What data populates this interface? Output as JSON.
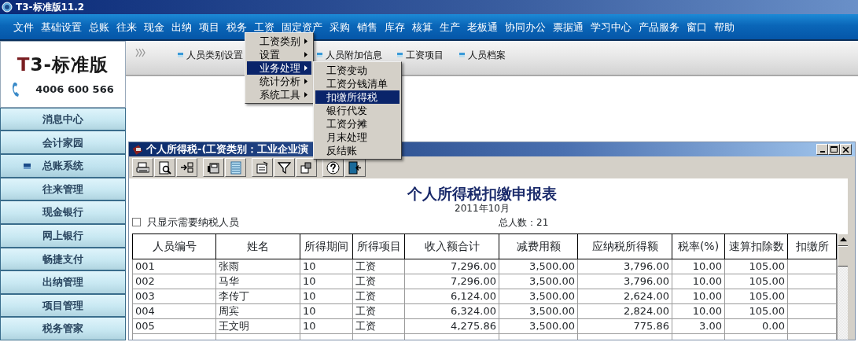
{
  "window": {
    "title": "T3-标准版11.2"
  },
  "menu_bar": [
    "文件",
    "基础设置",
    "总账",
    "往来",
    "现金",
    "出纳",
    "项目",
    "税务",
    "工资",
    "固定资产",
    "采购",
    "销售",
    "库存",
    "核算",
    "生产",
    "老板通",
    "协同办公",
    "票据通",
    "学习中心",
    "产品服务",
    "窗口",
    "帮助"
  ],
  "open_menu": [
    {
      "label": "工资类别",
      "selected": false
    },
    {
      "label": "设置",
      "selected": false
    },
    {
      "label": "业务处理",
      "selected": true
    },
    {
      "label": "统计分析",
      "selected": false
    },
    {
      "label": "系统工具",
      "selected": false
    }
  ],
  "submenu": [
    {
      "label": "工资变动",
      "selected": false
    },
    {
      "label": "工资分钱清单",
      "selected": false
    },
    {
      "label": "扣缴所得税",
      "selected": true
    },
    {
      "label": "银行代发",
      "selected": false
    },
    {
      "label": "工资分摊",
      "selected": false
    },
    {
      "label": "月末处理",
      "selected": false
    },
    {
      "label": "反结账",
      "selected": false
    }
  ],
  "sidebar": {
    "logo": "T3-标准版",
    "phone": "4006 600 566",
    "items": [
      {
        "label": "消息中心",
        "selected": false
      },
      {
        "label": "会计家园",
        "selected": false
      },
      {
        "label": "总账系统",
        "selected": true
      },
      {
        "label": "往来管理",
        "selected": false
      },
      {
        "label": "现金银行",
        "selected": false
      },
      {
        "label": "网上银行",
        "selected": false
      },
      {
        "label": "畅捷支付",
        "selected": false
      },
      {
        "label": "出纳管理",
        "selected": false
      },
      {
        "label": "项目管理",
        "selected": false
      },
      {
        "label": "税务管家",
        "selected": false
      }
    ]
  },
  "quick_links": [
    "人员类别设置",
    "人员附加信息",
    "工资项目",
    "人员档案"
  ],
  "child_window": {
    "title": "个人所得税-(工资类别：工业企业演",
    "report": {
      "title": "个人所得税扣缴申报表",
      "period": "2011年10月",
      "filter": {
        "label": "只显示需要纳税人员",
        "checked": false
      },
      "total": "总人数：21",
      "columns": [
        "人员编号",
        "姓名",
        "所得期间",
        "所得项目",
        "收入额合计",
        "减费用额",
        "应纳税所得额",
        "税率(%)",
        "速算扣除数",
        "扣缴所"
      ],
      "rows": [
        [
          "001",
          "张雨",
          "10",
          "工资",
          "7,296.00",
          "3,500.00",
          "3,796.00",
          "10.00",
          "105.00"
        ],
        [
          "002",
          "马华",
          "10",
          "工资",
          "7,296.00",
          "3,500.00",
          "3,796.00",
          "10.00",
          "105.00"
        ],
        [
          "003",
          "李传丁",
          "10",
          "工资",
          "6,124.00",
          "3,500.00",
          "2,624.00",
          "10.00",
          "105.00"
        ],
        [
          "004",
          "周宾",
          "10",
          "工资",
          "6,324.00",
          "3,500.00",
          "2,824.00",
          "10.00",
          "105.00"
        ],
        [
          "005",
          "王文明",
          "10",
          "工资",
          "4,275.86",
          "3,500.00",
          "775.86",
          "3.00",
          "0.00"
        ]
      ]
    }
  }
}
